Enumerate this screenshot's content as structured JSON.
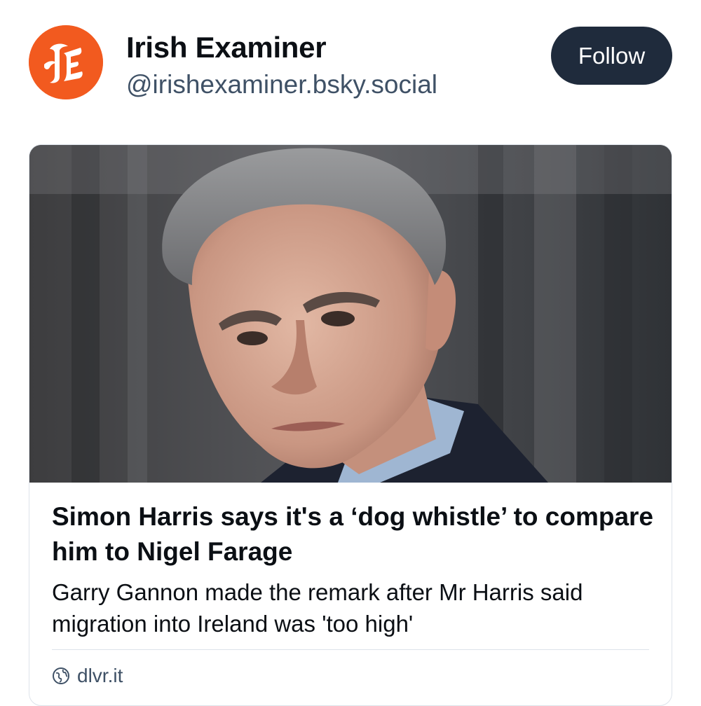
{
  "profile": {
    "name": "Irish Examiner",
    "handle": "@irishexaminer.bsky.social",
    "avatar_icon": "irish-examiner-logo",
    "avatar_color": "#f25a1f"
  },
  "follow_button": {
    "label": "Follow",
    "color": "#1f2b3c"
  },
  "link_card": {
    "image_alt": "Photo of a man with grey hair frowning",
    "title": "Simon Harris says it's a ‘dog whistle’ to compare him to Nigel Farage",
    "description": "Garry Gannon made the remark after Mr Harris said migration into Ireland was 'too high'",
    "source_icon": "globe-icon",
    "source": "dlvr.it"
  }
}
